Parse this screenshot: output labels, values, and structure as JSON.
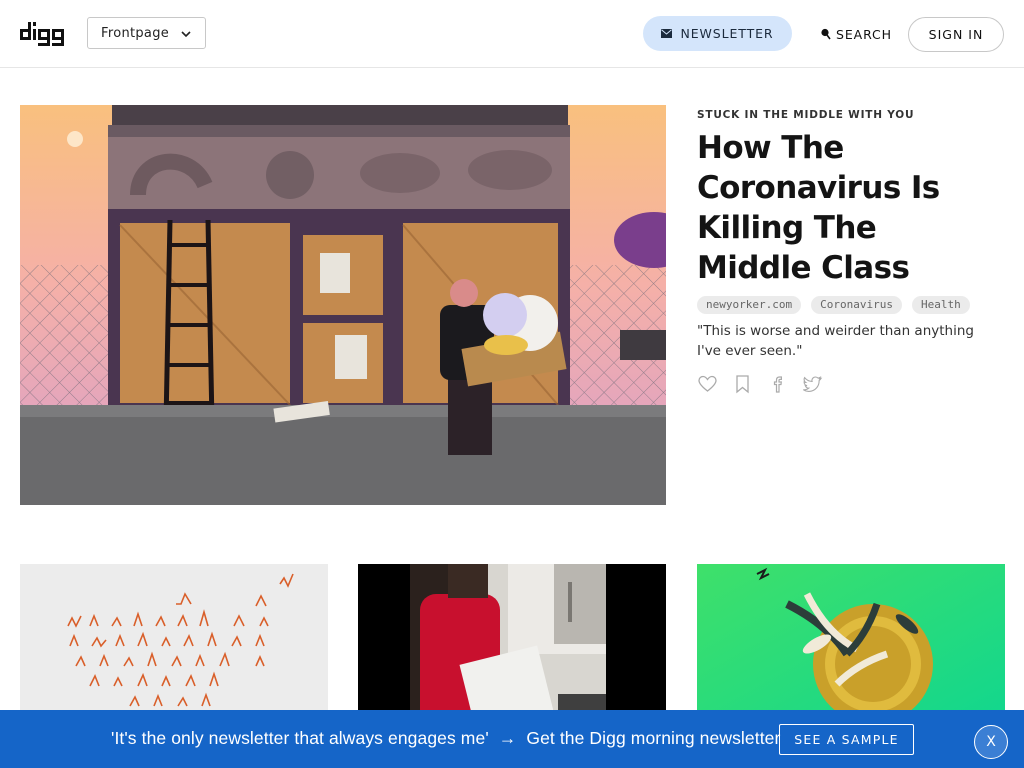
{
  "header": {
    "logo_text": "digg",
    "section_select": {
      "selected": "Frontpage"
    },
    "newsletter_label": "NEWSLETTER",
    "search_label": "SEARCH",
    "signin_label": "SIGN IN"
  },
  "featured": {
    "kicker": "STUCK IN THE MIDDLE WITH YOU",
    "headline": "How The Coronavirus Is Killing The Middle Class",
    "tags": [
      "newyorker.com",
      "Coronavirus",
      "Health"
    ],
    "blurb": "\"This is worse and weirder than anything I've ever seen.\"",
    "actions": [
      "heart-icon",
      "bookmark-icon",
      "facebook-icon",
      "twitter-icon"
    ]
  },
  "cards": [
    {
      "image": "orange-line-charts-map"
    },
    {
      "image": "person-with-box-video"
    },
    {
      "image": "gold-coin-green"
    }
  ],
  "promo_bar": {
    "quote": "'It's the only newsletter that always engages me'",
    "arrow": "→",
    "cta_text": "Get the Digg morning newsletter",
    "sample_label": "SEE A SAMPLE",
    "close_label": "X"
  },
  "colors": {
    "promo_bg": "#1565c8",
    "newsletter_pill": "#d4e5fb",
    "tag_bg": "#ebebeb"
  }
}
